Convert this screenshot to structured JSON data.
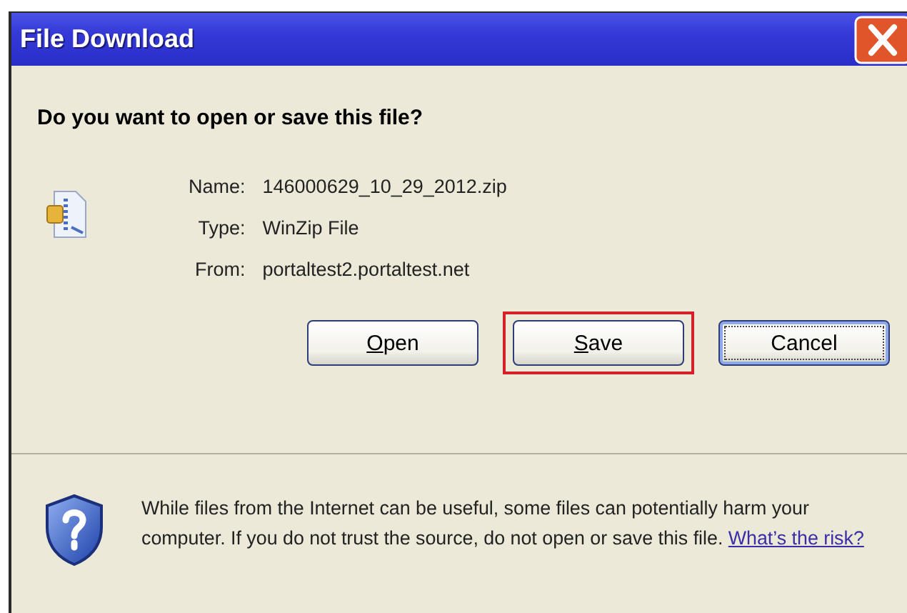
{
  "window": {
    "title": "File Download"
  },
  "heading": "Do you want to open or save this file?",
  "fields": [
    {
      "label": "Name:",
      "value": "146000629_10_29_2012.zip"
    },
    {
      "label": "Type:",
      "value": "WinZip File"
    },
    {
      "label": "From:",
      "value": "portaltest2.portaltest.net"
    }
  ],
  "buttons": [
    {
      "mnemonic": "O",
      "label": "pen",
      "default": false,
      "highlighted": false
    },
    {
      "mnemonic": "S",
      "label": "ave",
      "default": false,
      "highlighted": true
    },
    {
      "label": "Cancel",
      "default": true,
      "highlighted": false
    }
  ],
  "warning": {
    "text": "While files from the Internet can be useful, some files can potentially harm your computer. If you do not trust the source, do not open or save this file.",
    "link": "What’s the risk?"
  }
}
